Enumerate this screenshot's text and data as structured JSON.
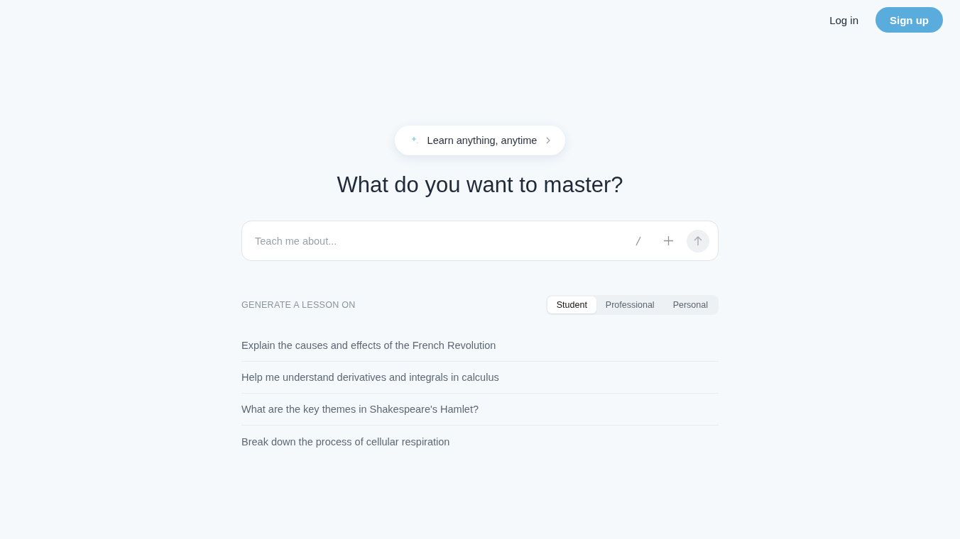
{
  "header": {
    "login": "Log in",
    "signup": "Sign up"
  },
  "announcement": {
    "label": "Learn anything, anytime"
  },
  "heading": "What do you want to master?",
  "prompt": {
    "placeholder": "Teach me about..."
  },
  "section_label": "GENERATE A LESSON ON",
  "tabs": [
    {
      "label": "Student",
      "selected": true
    },
    {
      "label": "Professional",
      "selected": false
    },
    {
      "label": "Personal",
      "selected": false
    }
  ],
  "suggestions": [
    "Explain the causes and effects of the French Revolution",
    "Help me understand derivatives and integrals in calculus",
    "What are the key themes in Shakespeare's Hamlet?",
    "Break down the process of cellular respiration"
  ]
}
